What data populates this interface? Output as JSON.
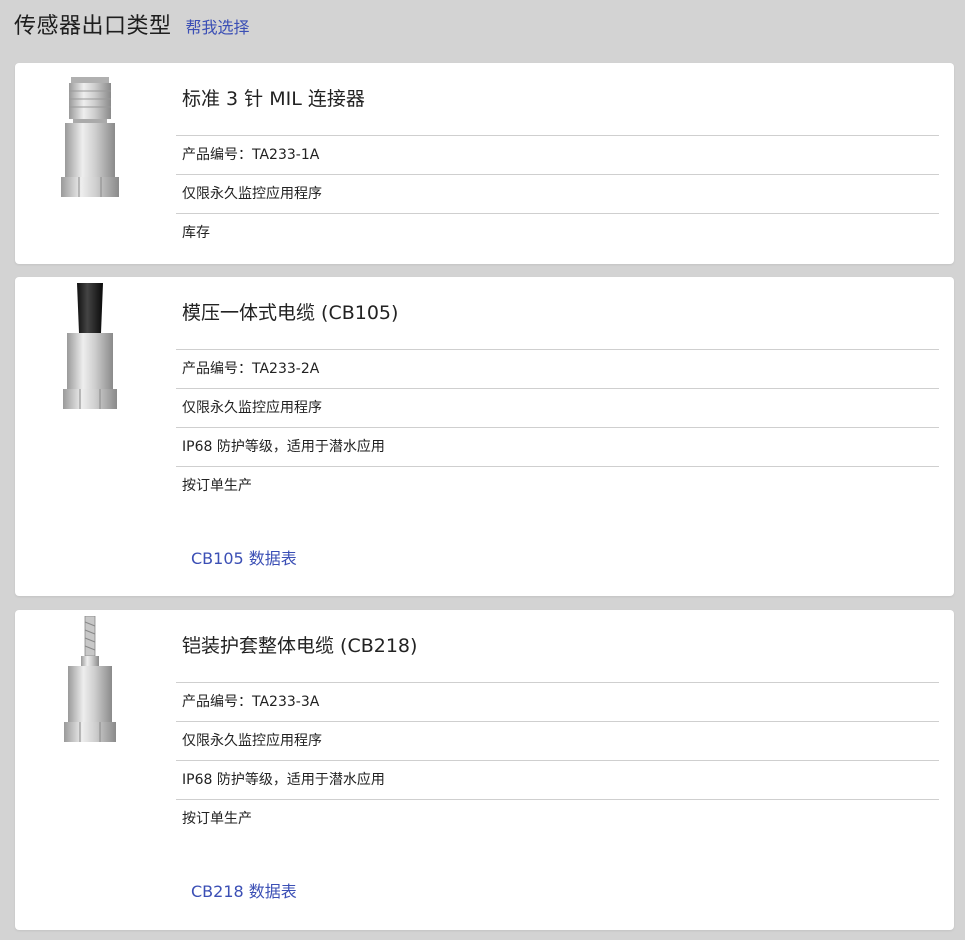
{
  "header": {
    "title": "传感器出口类型",
    "help_link": "帮我选择"
  },
  "products": [
    {
      "name": "标准 3 针 MIL 连接器",
      "part": "产品编号：TA233-1A",
      "features": [
        "仅限永久监控应用程序"
      ],
      "availability": "库存",
      "datasheet": ""
    },
    {
      "name": "模压一体式电缆 (CB105)",
      "part": "产品编号：TA233-2A",
      "features": [
        "仅限永久监控应用程序",
        "IP68 防护等级，适用于潜水应用"
      ],
      "availability": "按订单生产",
      "datasheet": "CB105 数据表"
    },
    {
      "name": "铠装护套整体电缆 (CB218)",
      "part": "产品编号：TA233-3A",
      "features": [
        "仅限永久监控应用程序",
        "IP68 防护等级，适用于潜水应用"
      ],
      "availability": "按订单生产",
      "datasheet": "CB218 数据表"
    }
  ],
  "colors": {
    "link": "#3b4fb5",
    "background": "#d3d3d3",
    "card": "#ffffff"
  }
}
